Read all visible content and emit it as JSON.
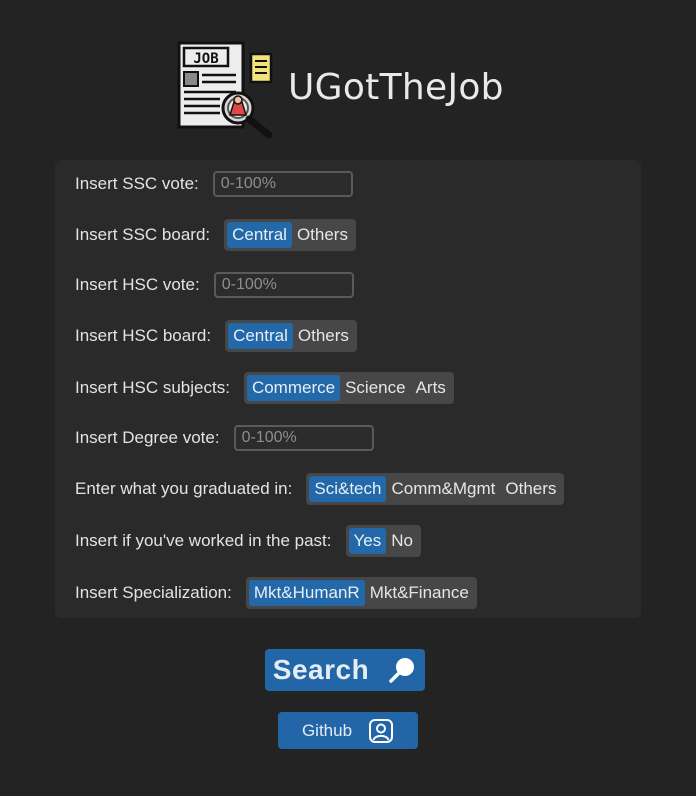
{
  "app": {
    "title": "UGotTheJob"
  },
  "form": {
    "ssc_vote": {
      "label": "Insert SSC vote:",
      "placeholder": "0-100%"
    },
    "ssc_board": {
      "label": "Insert SSC board:",
      "options": [
        "Central",
        "Others"
      ],
      "selected": "Central"
    },
    "hsc_vote": {
      "label": "Insert HSC vote:",
      "placeholder": "0-100%"
    },
    "hsc_board": {
      "label": "Insert HSC board:",
      "options": [
        "Central",
        "Others"
      ],
      "selected": "Central"
    },
    "hsc_subjects": {
      "label": "Insert HSC subjects:",
      "options": [
        "Commerce",
        "Science",
        "Arts"
      ],
      "selected": "Commerce"
    },
    "degree_vote": {
      "label": "Insert Degree vote:",
      "placeholder": "0-100%"
    },
    "graduated_in": {
      "label": "Enter what you graduated in:",
      "options": [
        "Sci&tech",
        "Comm&Mgmt",
        "Others"
      ],
      "selected": "Sci&tech"
    },
    "work_experience": {
      "label": "Insert if you've worked in the past:",
      "options": [
        "Yes",
        "No"
      ],
      "selected": "Yes"
    },
    "specialization": {
      "label": "Insert Specialization:",
      "options": [
        "Mkt&HumanR",
        "Mkt&Finance"
      ],
      "selected": "Mkt&HumanR"
    }
  },
  "buttons": {
    "search": "Search",
    "github": "Github"
  },
  "icons": {
    "logo": "job-search-icon",
    "search": "search-icon",
    "github": "user-profile-icon"
  },
  "colors": {
    "background": "#232323",
    "panel": "#2a2a2a",
    "accent": "#2366a7",
    "segment": "#474747"
  }
}
